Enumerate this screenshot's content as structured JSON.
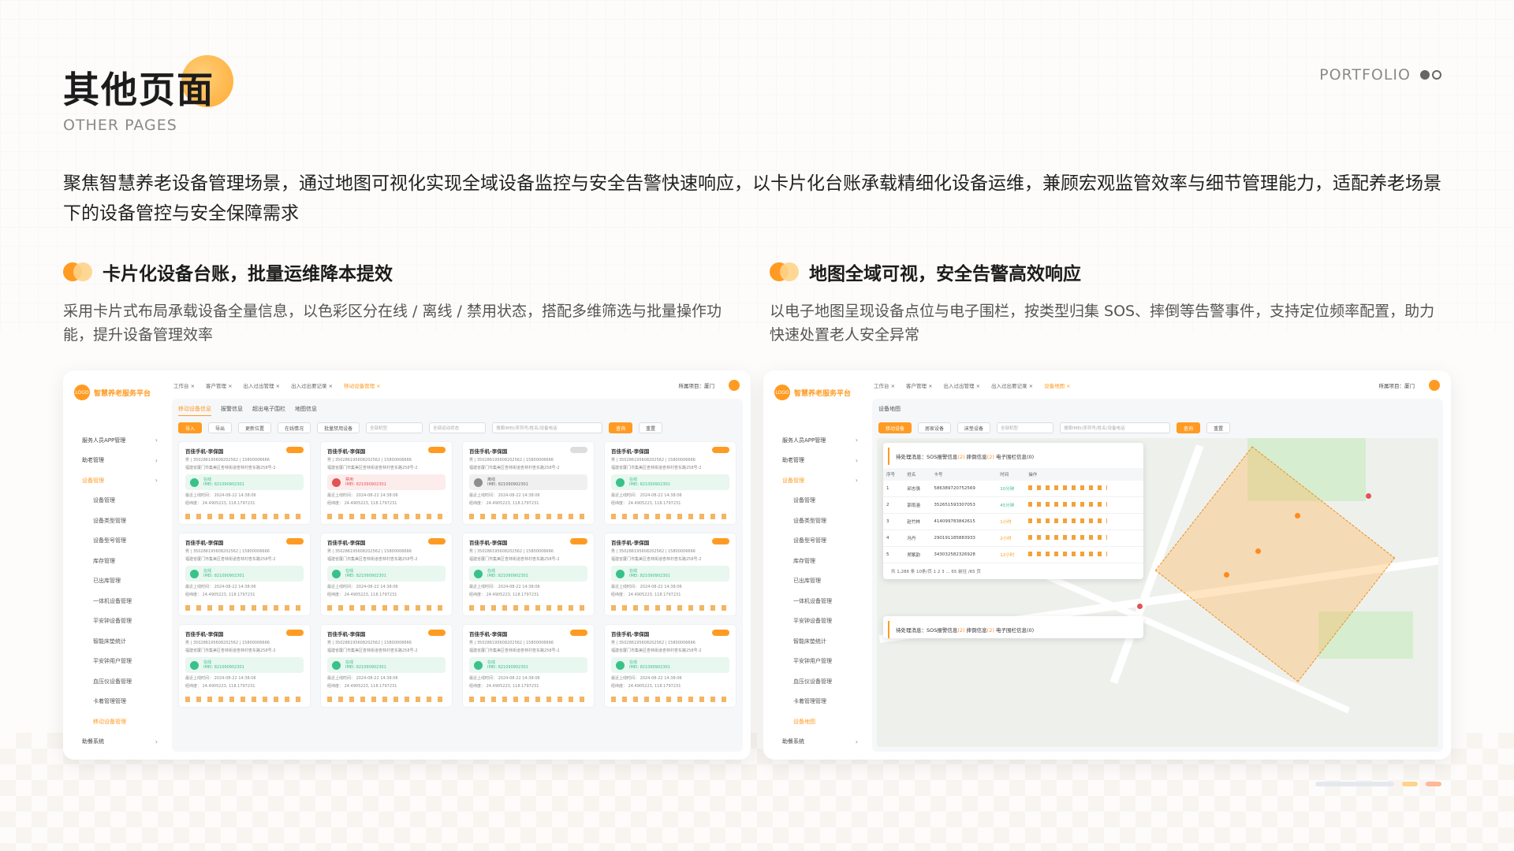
{
  "header": {
    "title": "其他页面",
    "subtitle": "OTHER PAGES",
    "portfolio": "PORTFOLIO"
  },
  "intro": "聚焦智慧养老设备管理场景，通过地图可视化实现全域设备监控与安全告警快速响应，以卡片化台账承载精细化设备运维，兼顾宏观监管效率与细节管理能力，适配养老场景下的设备管控与安全保障需求",
  "sections": [
    {
      "title": "卡片化设备台账，批量运维降本提效",
      "desc": "采用卡片式布局承载设备全量信息，以色彩区分在线 / 离线 / 禁用状态，搭配多维筛选与批量操作功能，提升设备管理效率"
    },
    {
      "title": "地图全域可视，安全告警高效响应",
      "desc": "以电子地图呈现设备点位与电子围栏，按类型归集 SOS、摔倒等告警事件，支持定位频率配置，助力快速处置老人安全异常"
    }
  ],
  "app": {
    "logo": "LOGO",
    "brand": "智慧养老服务平台",
    "tabs": [
      "工作台",
      "客户管理",
      "出入过出管理",
      "出入过出要记录",
      "移动设备管理"
    ],
    "tabs_map": [
      "工作台",
      "客户管理",
      "出入过出管理",
      "出入过出要记录",
      "设备地图"
    ],
    "project": "所属项目：厦门",
    "sidebar": [
      {
        "label": "服务人员APP管理",
        "sub": false
      },
      {
        "label": "助老管理",
        "sub": false
      },
      {
        "label": "设备管理",
        "sub": false,
        "active": true
      },
      {
        "label": "设备管理",
        "sub": true
      },
      {
        "label": "设备类型管理",
        "sub": true
      },
      {
        "label": "设备型号管理",
        "sub": true
      },
      {
        "label": "库存管理",
        "sub": true
      },
      {
        "label": "已出库管理",
        "sub": true
      },
      {
        "label": "一体机设备管理",
        "sub": true
      },
      {
        "label": "平安钟设备管理",
        "sub": true
      },
      {
        "label": "智能床垫统计",
        "sub": true
      },
      {
        "label": "平安钟用户管理",
        "sub": true
      },
      {
        "label": "血压仪设备管理",
        "sub": true
      },
      {
        "label": "卡着管理管理",
        "sub": true
      },
      {
        "label": "移动设备管理",
        "sub": true,
        "active": true
      },
      {
        "label": "助餐系统",
        "sub": false
      }
    ],
    "sidebar_map_active": "设备地图",
    "subtabs": [
      "移动设备信息",
      "报警信息",
      "超出电子围栏",
      "地图信息"
    ],
    "toolbar": [
      "导入",
      "导出",
      "更新位置",
      "在线情况",
      "批量禁用设备"
    ],
    "selects": [
      "全部机型",
      "全部运动状态"
    ],
    "search_placeholder": "搜索IMEI/序列号/姓名/设备电话",
    "query": "查询",
    "reset": "重置",
    "cards": [
      {
        "title": "百佳手机-李保国",
        "status": "在线",
        "tone": "green"
      },
      {
        "title": "百佳手机-李保国",
        "status": "禁用",
        "tone": "red"
      },
      {
        "title": "百佳手机-李保国",
        "status": "离线",
        "tone": "gray"
      },
      {
        "title": "百佳手机-李保国",
        "status": "在线",
        "tone": "green"
      },
      {
        "title": "百佳手机-李保国",
        "status": "在线",
        "tone": "green"
      },
      {
        "title": "百佳手机-李保国",
        "status": "在线",
        "tone": "green"
      },
      {
        "title": "百佳手机-李保国",
        "status": "在线",
        "tone": "green"
      },
      {
        "title": "百佳手机-李保国",
        "status": "在线",
        "tone": "green"
      },
      {
        "title": "百佳手机-李保国",
        "status": "在线",
        "tone": "green"
      },
      {
        "title": "百佳手机-李保国",
        "status": "在线",
        "tone": "green"
      },
      {
        "title": "百佳手机-李保国",
        "status": "在线",
        "tone": "green"
      },
      {
        "title": "百佳手机-李保国",
        "status": "在线",
        "tone": "green"
      }
    ],
    "card_line1": "男 | 35028619560820256​2 | 15800006666",
    "card_line2": "福建省厦门市集美区杏林街道杏林村杏东路258号-2",
    "card_imei": "IMEI: 821090902301",
    "card_time_label": "最近上线时间：",
    "card_time": "2024-08-22 14:38:06",
    "card_geo_label": "经纬度：",
    "card_geo": "24.4905223, 118.1797231",
    "map_title": "设备地图",
    "map_tabs": [
      "移动设备",
      "居家设备",
      "床垫设备"
    ],
    "panel_title": "待处理消息：SOS报警信息",
    "panel_sos": "(2)",
    "panel_fall": "摔倒信息",
    "panel_fall_n": "(2)",
    "panel_fence": "电子围栏信息",
    "panel_fence_n": "(0)",
    "table_headers": [
      "序号",
      "姓名",
      "卡号",
      "时间",
      "操作"
    ],
    "rows": [
      {
        "no": "1",
        "name": "邱志强",
        "card": "586389720752569",
        "time": "10分钟"
      },
      {
        "no": "2",
        "name": "郭雨涵",
        "card": "352651593307053",
        "time": "45分钟"
      },
      {
        "no": "3",
        "name": "赵竹林",
        "card": "414099783842615",
        "time": "1小时"
      },
      {
        "no": "4",
        "name": "冯丹",
        "card": "290191185883933",
        "time": "2小时"
      },
      {
        "no": "5",
        "name": "郑紫韵",
        "card": "343032582326928",
        "time": "12小时"
      }
    ],
    "pager": "共 1,286 条   10条/页   1  2  3 ... 65   前往  /65 页"
  },
  "colors": {
    "accent": "#ff9b22",
    "online": "#38c28a",
    "disabled": "#e35353",
    "offline": "#8d8d8d"
  }
}
